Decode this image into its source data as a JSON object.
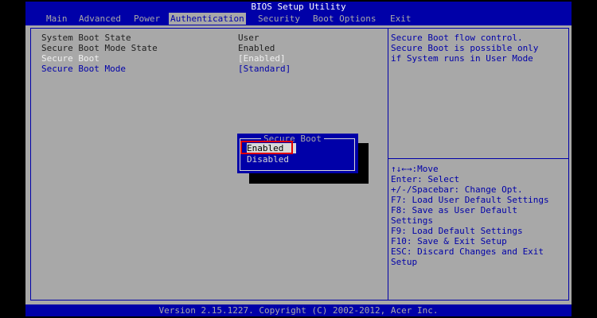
{
  "title": "BIOS Setup Utility",
  "menu": {
    "items": [
      "Main",
      "Advanced",
      "Power",
      "Authentication",
      "Security",
      "Boot Options",
      "Exit"
    ],
    "active": "Authentication"
  },
  "settings": [
    {
      "label": "System Boot State",
      "value": "User"
    },
    {
      "label": "Secure Boot Mode State",
      "value": "Enabled"
    },
    {
      "label": "Secure Boot",
      "value": "[Enabled]"
    },
    {
      "label": "Secure Boot Mode",
      "value": "[Standard]"
    }
  ],
  "help": {
    "description": [
      "Secure Boot flow control.",
      "Secure Boot is possible only",
      "if System runs in User Mode"
    ],
    "keys": [
      "↑↓←→:Move",
      "Enter: Select",
      "+/-/Spacebar: Change Opt.",
      "F7: Load User Default Settings",
      "F8: Save as User Default",
      "Settings",
      "F9: Load Default Settings",
      "F10: Save & Exit Setup",
      "ESC: Discard Changes and Exit",
      "Setup"
    ]
  },
  "popup": {
    "title": "Secure Boot",
    "options": [
      "Enabled",
      "Disabled"
    ],
    "selected": "Enabled"
  },
  "footer": "Version 2.15.1227. Copyright (C) 2002-2012, Acer Inc.",
  "colors": {
    "background": "#a8a8a8",
    "accent": "#0000a8",
    "highlight_box": "#e00000"
  }
}
